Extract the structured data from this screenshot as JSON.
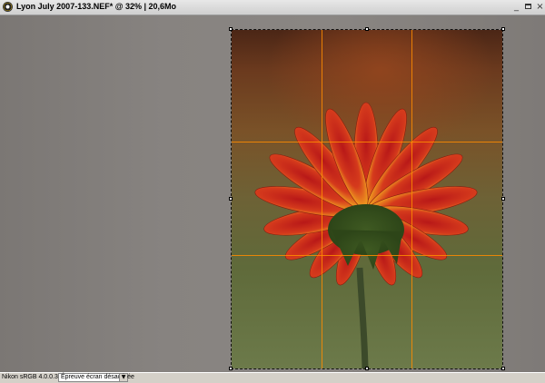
{
  "window": {
    "title": "Lyon July 2007-133.NEF* @ 32% | 20,6Mo"
  },
  "controls": {
    "minimize_glyph": "_",
    "close_glyph": "×"
  },
  "image": {
    "icon": "flower-photo"
  },
  "statusbar": {
    "color_profile": "Nikon sRGB 4.0.0.3001",
    "soft_proof_value": "Épreuve écran désactivée",
    "dropdown_glyph": "▼"
  },
  "colors": {
    "crop_grid": "#ff8c00",
    "canvas_gray": "#858180"
  }
}
